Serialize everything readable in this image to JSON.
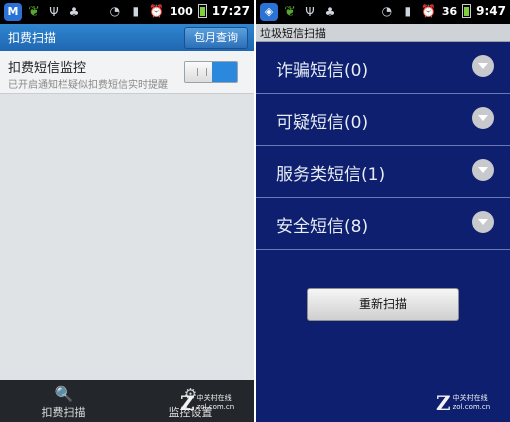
{
  "left_screen": {
    "status_bar": {
      "icons_left": [
        "app-shield-badge",
        "pea-icon",
        "usb-icon",
        "android-icon"
      ],
      "battery_pct": "100",
      "time": "17:27",
      "icons_right": [
        "wifi-icon",
        "signal-icon",
        "alarm-icon"
      ]
    },
    "title": "扣费扫描",
    "package_query_button": "包月查询",
    "setting": {
      "title": "扣费短信监控",
      "description": "已开启通知栏疑似扣费短信实时提醒",
      "toggle_on": true
    },
    "tabs": [
      {
        "label": "扣费扫描",
        "icon": "scan-search-icon"
      },
      {
        "label": "监控设置",
        "icon": "settings-icon"
      }
    ],
    "watermark": {
      "brand": "中关村在线",
      "url": "zol.com.cn"
    }
  },
  "right_screen": {
    "status_bar": {
      "icons_left": [
        "shield-badge",
        "pea-icon",
        "usb-icon",
        "android-icon"
      ],
      "battery_pct": "36",
      "time": "9:47",
      "icons_right": [
        "wifi-icon",
        "signal-icon",
        "alarm-icon"
      ]
    },
    "title": "垃圾短信扫描",
    "categories": [
      {
        "label": "诈骗短信(0)"
      },
      {
        "label": "可疑短信(0)"
      },
      {
        "label": "服务类短信(1)"
      },
      {
        "label": "安全短信(8)"
      }
    ],
    "rescan_button": "重新扫描",
    "watermark": {
      "brand": "中关村在线",
      "url": "zol.com.cn"
    }
  },
  "colors": {
    "left_title_bar": "#1f66b2",
    "toggle_on": "#2b88dd",
    "right_background": "#0d1f6e",
    "bottom_bar": "#23272b"
  }
}
